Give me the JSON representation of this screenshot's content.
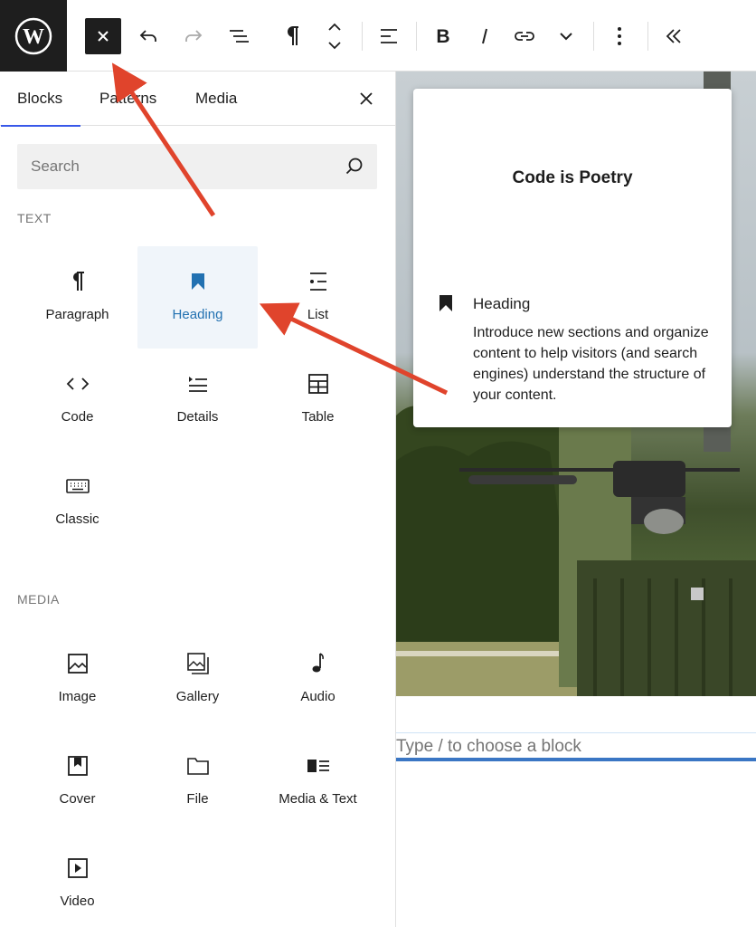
{
  "toolbar": {
    "logo": "wordpress-logo",
    "buttons": [
      "close-inserter",
      "undo",
      "redo",
      "document-overview",
      "paragraph",
      "move-up-down",
      "align",
      "bold",
      "italic",
      "link",
      "more-rich-text",
      "options",
      "collapse"
    ]
  },
  "sidebar": {
    "tabs": [
      {
        "label": "Blocks"
      },
      {
        "label": "Patterns"
      },
      {
        "label": "Media"
      }
    ],
    "search": {
      "placeholder": "Search"
    },
    "sections": [
      {
        "title": "TEXT",
        "blocks": [
          {
            "label": "Paragraph",
            "icon": "paragraph-icon"
          },
          {
            "label": "Heading",
            "icon": "bookmark-icon"
          },
          {
            "label": "List",
            "icon": "list-icon"
          },
          {
            "label": "Code",
            "icon": "code-icon"
          },
          {
            "label": "Details",
            "icon": "details-icon"
          },
          {
            "label": "Table",
            "icon": "table-icon"
          },
          {
            "label": "Classic",
            "icon": "keyboard-icon"
          }
        ]
      },
      {
        "title": "MEDIA",
        "blocks": [
          {
            "label": "Image",
            "icon": "image-icon"
          },
          {
            "label": "Gallery",
            "icon": "gallery-icon"
          },
          {
            "label": "Audio",
            "icon": "audio-icon"
          },
          {
            "label": "Cover",
            "icon": "cover-icon"
          },
          {
            "label": "File",
            "icon": "folder-icon"
          },
          {
            "label": "Media & Text",
            "icon": "media-text-icon"
          },
          {
            "label": "Video",
            "icon": "video-icon"
          }
        ]
      }
    ]
  },
  "preview": {
    "example_text": "Code is Poetry",
    "block_name": "Heading",
    "description": "Introduce new sections and organize content to help visitors (and search engines) understand the structure of your content."
  },
  "canvas": {
    "appender_placeholder": "Type / to choose a block"
  },
  "colors": {
    "accent": "#2271b1",
    "annotation_arrow": "#e0442c",
    "dark": "#1e1e1e"
  }
}
